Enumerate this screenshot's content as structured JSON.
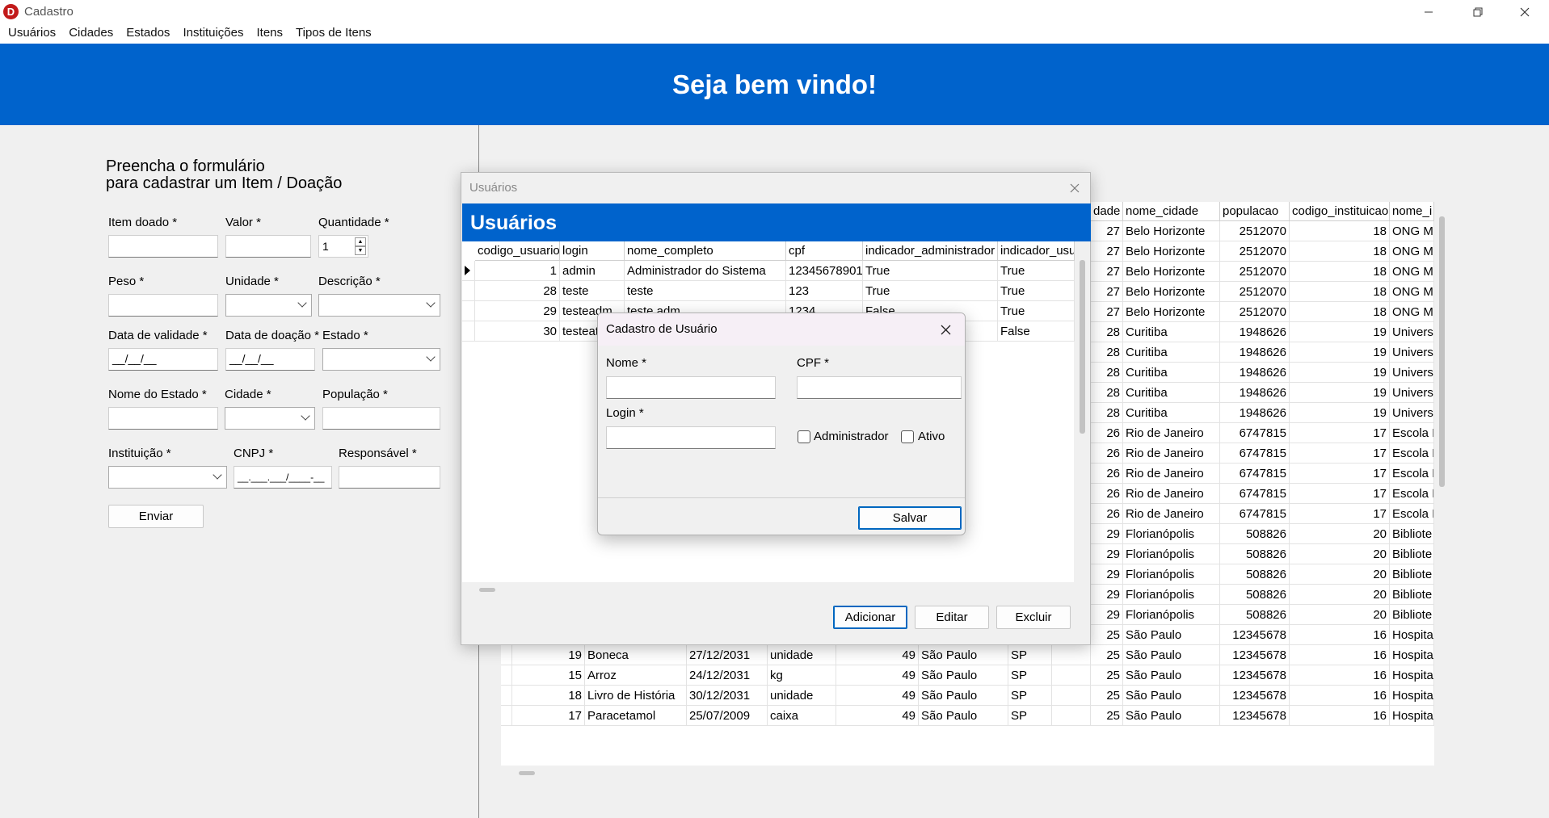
{
  "window": {
    "title": "Cadastro",
    "icon_letter": "D"
  },
  "menu": [
    "Usuários",
    "Cidades",
    "Estados",
    "Instituições",
    "Itens",
    "Tipos de Itens"
  ],
  "banner": {
    "title": "Seja bem vindo!"
  },
  "form": {
    "heading_line1": "Preencha o formulário",
    "heading_line2": "para cadastrar um Item / Doação",
    "labels": {
      "item_doado": "Item doado *",
      "valor": "Valor *",
      "quantidade": "Quantidade *",
      "peso": "Peso *",
      "unidade": "Unidade *",
      "descricao": "Descrição *",
      "data_validade": "Data de validade *",
      "data_doacao": "Data de doação *",
      "estado": "Estado *",
      "nome_estado": "Nome do Estado *",
      "cidade": "Cidade *",
      "populacao": "População *",
      "instituicao": "Instituição *",
      "cnpj": "CNPJ *",
      "responsavel": "Responsável *"
    },
    "quantidade_value": "1",
    "date_mask": "__/__/__",
    "cnpj_mask": "__.___.___/____-__",
    "enviar_label": "Enviar"
  },
  "background_grid": {
    "columns": [
      "dade",
      "nome_cidade",
      "populacao",
      "codigo_instituicao",
      "nome_i"
    ],
    "right_rows": [
      [
        "27",
        "Belo Horizonte",
        "2512070",
        "18",
        "ONG M"
      ],
      [
        "27",
        "Belo Horizonte",
        "2512070",
        "18",
        "ONG M"
      ],
      [
        "27",
        "Belo Horizonte",
        "2512070",
        "18",
        "ONG M"
      ],
      [
        "27",
        "Belo Horizonte",
        "2512070",
        "18",
        "ONG M"
      ],
      [
        "27",
        "Belo Horizonte",
        "2512070",
        "18",
        "ONG M"
      ],
      [
        "28",
        "Curitiba",
        "1948626",
        "19",
        "Univers"
      ],
      [
        "28",
        "Curitiba",
        "1948626",
        "19",
        "Univers"
      ],
      [
        "28",
        "Curitiba",
        "1948626",
        "19",
        "Univers"
      ],
      [
        "28",
        "Curitiba",
        "1948626",
        "19",
        "Univers"
      ],
      [
        "28",
        "Curitiba",
        "1948626",
        "19",
        "Univers"
      ],
      [
        "26",
        "Rio de Janeiro",
        "6747815",
        "17",
        "Escola F"
      ],
      [
        "26",
        "Rio de Janeiro",
        "6747815",
        "17",
        "Escola F"
      ],
      [
        "26",
        "Rio de Janeiro",
        "6747815",
        "17",
        "Escola F"
      ],
      [
        "26",
        "Rio de Janeiro",
        "6747815",
        "17",
        "Escola F"
      ],
      [
        "26",
        "Rio de Janeiro",
        "6747815",
        "17",
        "Escola F"
      ],
      [
        "29",
        "Florianópolis",
        "508826",
        "20",
        "Bibliote"
      ],
      [
        "29",
        "Florianópolis",
        "508826",
        "20",
        "Bibliote"
      ],
      [
        "29",
        "Florianópolis",
        "508826",
        "20",
        "Bibliote"
      ],
      [
        "29",
        "Florianópolis",
        "508826",
        "20",
        "Bibliote"
      ],
      [
        "29",
        "Florianópolis",
        "508826",
        "20",
        "Bibliote"
      ],
      [
        "25",
        "São Paulo",
        "12345678",
        "16",
        "Hospita"
      ],
      [
        "25",
        "São Paulo",
        "12345678",
        "16",
        "Hospita"
      ],
      [
        "25",
        "São Paulo",
        "12345678",
        "16",
        "Hospita"
      ],
      [
        "25",
        "São Paulo",
        "12345678",
        "16",
        "Hospita"
      ],
      [
        "25",
        "São Paulo",
        "12345678",
        "16",
        "Hospita"
      ]
    ],
    "left_rows": [
      [
        "19",
        "Boneca",
        "27/12/2031",
        "unidade",
        "49",
        "São Paulo",
        "SP"
      ],
      [
        "15",
        "Arroz",
        "24/12/2031",
        "kg",
        "49",
        "São Paulo",
        "SP"
      ],
      [
        "18",
        "Livro de História",
        "30/12/2031",
        "unidade",
        "49",
        "São Paulo",
        "SP"
      ],
      [
        "17",
        "Paracetamol",
        "25/07/2009",
        "caixa",
        "49",
        "São Paulo",
        "SP"
      ]
    ]
  },
  "usuarios_dialog": {
    "window_title": "Usuários",
    "heading": "Usuários",
    "columns": [
      "codigo_usuario",
      "login",
      "nome_completo",
      "cpf",
      "indicador_administrador",
      "indicador_usua"
    ],
    "rows": [
      [
        "1",
        "admin",
        "Administrador do Sistema",
        "12345678901",
        "True",
        "True"
      ],
      [
        "28",
        "teste",
        "teste",
        "123",
        "True",
        "True"
      ],
      [
        "29",
        "testeadm",
        "teste adm",
        "1234",
        "False",
        "True"
      ],
      [
        "30",
        "testeat",
        "",
        "",
        "",
        "False"
      ]
    ],
    "buttons": {
      "adicionar": "Adicionar",
      "editar": "Editar",
      "excluir": "Excluir"
    }
  },
  "cadastro_dialog": {
    "title": "Cadastro de Usuário",
    "labels": {
      "nome": "Nome *",
      "cpf": "CPF *",
      "login": "Login *"
    },
    "checkboxes": {
      "administrador": "Administrador",
      "ativo": "Ativo"
    },
    "salvar_label": "Salvar"
  },
  "colors": {
    "accent": "#0063cc",
    "button_border_primary": "#0067c0"
  }
}
